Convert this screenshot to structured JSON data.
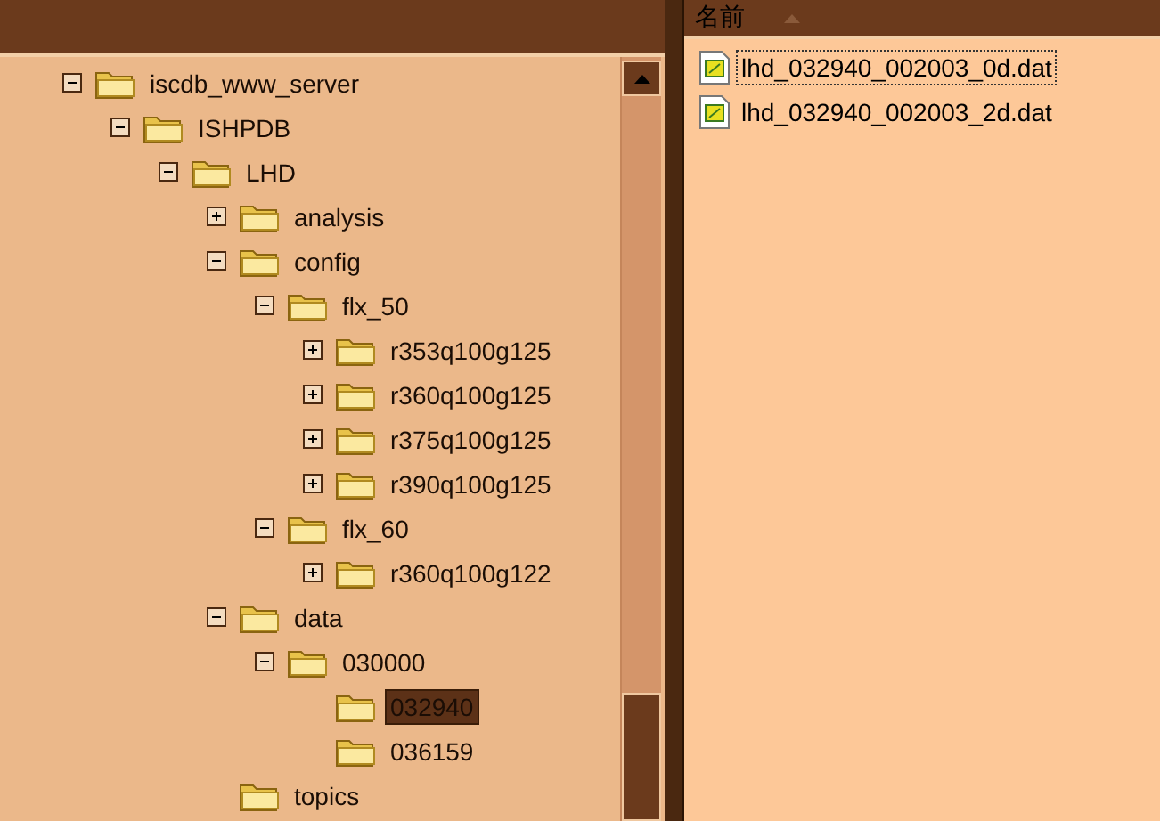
{
  "tree": [
    {
      "label": "iscdb_www_server",
      "expanded": true,
      "selected": false,
      "children": [
        {
          "label": "ISHPDB",
          "expanded": true,
          "selected": false,
          "children": [
            {
              "label": "LHD",
              "expanded": true,
              "selected": false,
              "children": [
                {
                  "label": "analysis",
                  "expanded": false,
                  "selected": false
                },
                {
                  "label": "config",
                  "expanded": true,
                  "selected": false,
                  "children": [
                    {
                      "label": "flx_50",
                      "expanded": true,
                      "selected": false,
                      "children": [
                        {
                          "label": "r353q100g125",
                          "expanded": false,
                          "selected": false
                        },
                        {
                          "label": "r360q100g125",
                          "expanded": false,
                          "selected": false
                        },
                        {
                          "label": "r375q100g125",
                          "expanded": false,
                          "selected": false
                        },
                        {
                          "label": "r390q100g125",
                          "expanded": false,
                          "selected": false
                        }
                      ]
                    },
                    {
                      "label": "flx_60",
                      "expanded": true,
                      "selected": false,
                      "children": [
                        {
                          "label": "r360q100g122",
                          "expanded": false,
                          "selected": false
                        }
                      ]
                    }
                  ]
                },
                {
                  "label": "data",
                  "expanded": true,
                  "selected": false,
                  "children": [
                    {
                      "label": "030000",
                      "expanded": true,
                      "selected": false,
                      "children": [
                        {
                          "label": "032940",
                          "selected": true
                        },
                        {
                          "label": "036159",
                          "selected": false
                        }
                      ]
                    }
                  ]
                },
                {
                  "label": "topics",
                  "selected": false
                }
              ]
            }
          ]
        }
      ]
    }
  ],
  "file_list": {
    "column": "名前",
    "files": [
      {
        "name": "lhd_032940_002003_0d.dat",
        "focused": true
      },
      {
        "name": "lhd_032940_002003_2d.dat",
        "focused": false
      }
    ]
  }
}
